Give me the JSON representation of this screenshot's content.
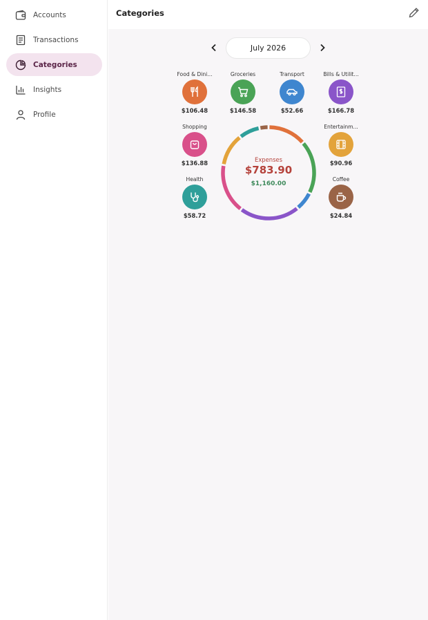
{
  "sidebar": {
    "items": [
      {
        "label": "Accounts",
        "icon": "wallet-icon"
      },
      {
        "label": "Transactions",
        "icon": "receipt-icon"
      },
      {
        "label": "Categories",
        "icon": "pie-chart-icon",
        "active": true
      },
      {
        "label": "Insights",
        "icon": "bar-chart-icon"
      },
      {
        "label": "Profile",
        "icon": "person-icon"
      }
    ]
  },
  "header": {
    "title": "Categories",
    "edit_icon": "pencil-icon"
  },
  "month_nav": {
    "label": "July 2026",
    "prev_icon": "chevron-left-icon",
    "next_icon": "chevron-right-icon"
  },
  "summary": {
    "expenses_label": "Expenses",
    "expenses_total": "$783.90",
    "income_total": "$1,160.00"
  },
  "categories": [
    {
      "name": "Food & Dini...",
      "amount": "$106.48",
      "color": "#e0713b",
      "icon": "fork-knife-icon",
      "value": 106.48
    },
    {
      "name": "Groceries",
      "amount": "$146.58",
      "color": "#4aa356",
      "icon": "cart-icon",
      "value": 146.58
    },
    {
      "name": "Transport",
      "amount": "$52.66",
      "color": "#3f86cf",
      "icon": "car-icon",
      "value": 52.66
    },
    {
      "name": "Bills & Utilit...",
      "amount": "$166.78",
      "color": "#8a55c9",
      "icon": "bill-icon",
      "value": 166.78
    },
    {
      "name": "Shopping",
      "amount": "$136.88",
      "color": "#d9508a",
      "icon": "shopping-bag-icon",
      "value": 136.88
    },
    {
      "name": "Entertainm...",
      "amount": "$90.96",
      "color": "#e3a33b",
      "icon": "film-icon",
      "value": 90.96
    },
    {
      "name": "Health",
      "amount": "$58.72",
      "color": "#2f9f9a",
      "icon": "stethoscope-icon",
      "value": 58.72
    },
    {
      "name": "Coffee",
      "amount": "$24.84",
      "color": "#9a6447",
      "icon": "coffee-cup-icon",
      "value": 24.84
    }
  ],
  "colors": {
    "accent": "#5b2548",
    "active_bg": "#f3e3ee",
    "expense": "#b5423b",
    "income": "#3e8a5b"
  }
}
